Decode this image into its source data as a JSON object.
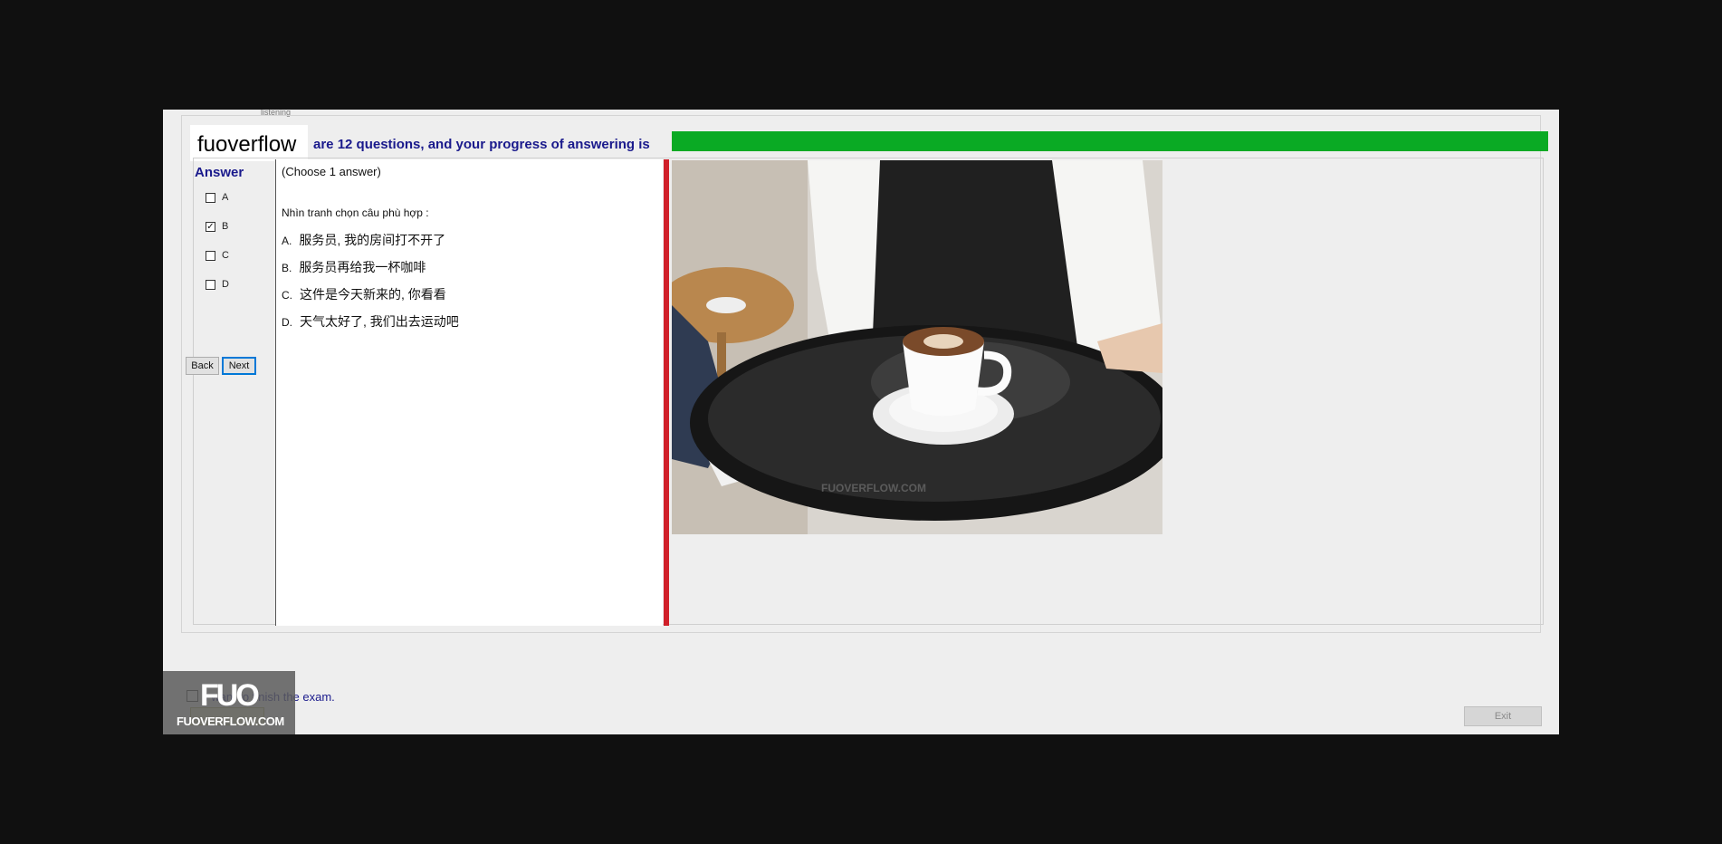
{
  "window": {
    "tab_label": "listening",
    "logo_text": "fuoverflow",
    "progress_text": "are 12 questions, and your progress of answering is",
    "progress_fraction": 1.0
  },
  "answer_panel": {
    "title": "Answer",
    "options": [
      {
        "label": "A",
        "checked": false
      },
      {
        "label": "B",
        "checked": true
      },
      {
        "label": "C",
        "checked": false
      },
      {
        "label": "D",
        "checked": false
      }
    ],
    "back_label": "Back",
    "next_label": "Next"
  },
  "question": {
    "instruction": "(Choose 1 answer)",
    "prompt": "Nhìn tranh chọn câu phù hợp :",
    "options": [
      {
        "letter": "A.",
        "text": "服务员, 我的房间打不开了"
      },
      {
        "letter": "B.",
        "text": "服务员再给我一杯咖啡"
      },
      {
        "letter": "C.",
        "text": "这件是今天新来的, 你看看"
      },
      {
        "letter": "D.",
        "text": "天气太好了, 我们出去运动吧"
      }
    ]
  },
  "photo": {
    "watermark_text": "FUOVERFLOW.COM"
  },
  "footer": {
    "finish_text": "I want to finish the exam.",
    "exit_label": "Exit",
    "badge_big": "FUO",
    "badge_small": "FUOVERFLOW.COM"
  },
  "colors": {
    "progress_fill": "#0aaa24",
    "label_blue": "#1a1a8c",
    "divider_red": "#d0202a",
    "next_border": "#0078d7"
  }
}
